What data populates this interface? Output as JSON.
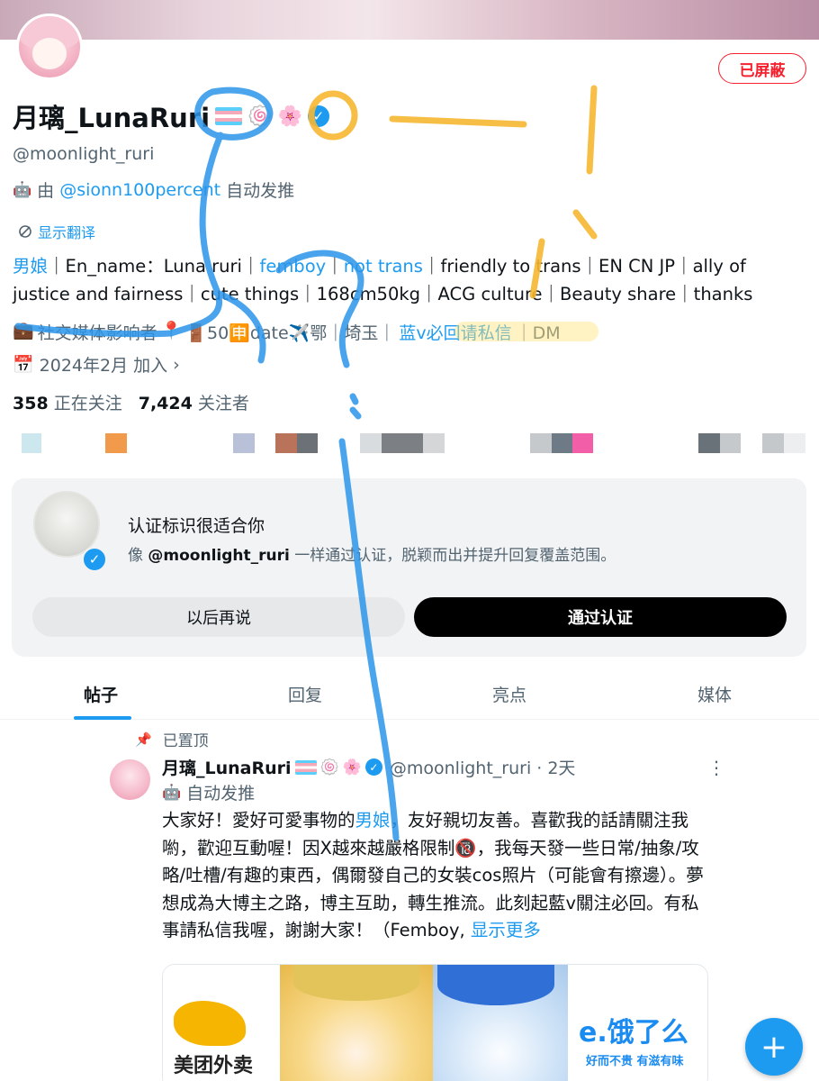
{
  "profile": {
    "display_name": "月璃_LunaRuri",
    "name_emojis": [
      "🍥",
      "🌸"
    ],
    "verified_mark": "✓",
    "handle": "@moonlight_ruri",
    "auto_by_prefix": "由",
    "auto_by_account": "@sionn100percent",
    "auto_by_suffix": "自动发推",
    "translate_label": "显示翻译",
    "blocked_label": "已屏蔽",
    "bio": {
      "seg1": "男娘",
      "seg2": "｜En_name：Luna ruri｜",
      "seg3": "femboy",
      "seg4": "｜",
      "seg5": "not trans",
      "seg6": "｜friendly to trans｜EN CN JP｜ally of justice and fairness｜cute things｜168cm50kg｜ACG culture｜Beauty share｜thanks"
    },
    "category": "社交媒体影响者",
    "location_text": "🚪50🈸date✈️鄂｜埼玉｜",
    "location_highlight": "蓝v必回请私信",
    "location_tail": "｜DM",
    "joined": "2024年2月 加入",
    "following_count": "358",
    "following_label": "正在关注",
    "followers_count": "7,424",
    "followers_label": "关注者"
  },
  "verify_card": {
    "title": "认证标识很适合你",
    "desc_prefix": "像",
    "desc_handle": "@moonlight_ruri",
    "desc_suffix": "一样通过认证，脱颖而出并提升回复覆盖范围。",
    "later_button": "以后再说",
    "verify_button": "通过认证"
  },
  "tabs": [
    "帖子",
    "回复",
    "亮点",
    "媒体"
  ],
  "post": {
    "pinned_label": "已置顶",
    "author": "月璃_LunaRuri",
    "handle_time": "@moonlight_ruri · 2天",
    "auto_label": "自动发推",
    "text_before": "大家好！愛好可愛事物的",
    "text_highlight": "男娘",
    "text_after": "，友好親切友善。喜歡我的話請關注我喲，歡迎互動喔！因X越來越嚴格限制🔞，我每天發一些日常/抽象/攻略/吐槽/有趣的東西，偶爾發自己的女裝cos照片（可能會有擦邊）。夢想成為大博主之路，博主互助，轉生推流。此刻起藍v關注必回。有私事請私信我喔，謝謝大家！（Femboy, ",
    "show_more": "显示更多",
    "media_left_brand": "美团外卖",
    "media_right_brand": "e.饿了么",
    "media_right_slogan": "好而不贵 有滋有味"
  },
  "fab_label": "+",
  "colors": {
    "accent": "#1d9bf0",
    "blocked": "#f4212e",
    "annotation_blue": "#2b95ea",
    "annotation_yellow": "#f7b731"
  }
}
